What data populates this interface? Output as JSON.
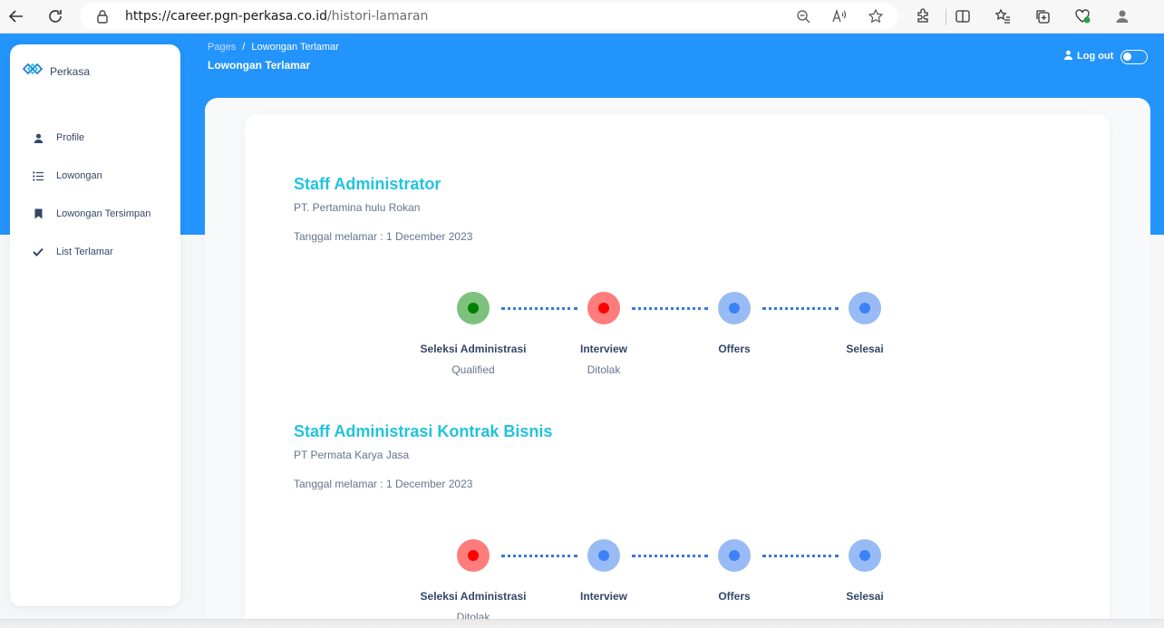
{
  "browser": {
    "url_host": "https://career.pgn-perkasa.co.id",
    "url_path": "/histori-lamaran"
  },
  "sidebar": {
    "brand": "Perkasa",
    "items": [
      {
        "label": "Profile",
        "icon": "user-icon"
      },
      {
        "label": "Lowongan",
        "icon": "list-icon"
      },
      {
        "label": "Lowongan Tersimpan",
        "icon": "bookmark-icon"
      },
      {
        "label": "List Terlamar",
        "icon": "check-icon"
      }
    ]
  },
  "header": {
    "breadcrumb_root": "Pages",
    "breadcrumb_sep": "/",
    "breadcrumb_current": "Lowongan Terlamar",
    "title": "Lowongan Terlamar",
    "logout_label": "Log out"
  },
  "colors": {
    "header_blue": "#2394fb",
    "title_cyan": "#22c3dd",
    "qualified_green": "#008000",
    "rejected_red": "#ff0000",
    "pending_blue": "#3b82f6"
  },
  "applications": [
    {
      "title": "Staff Administrator",
      "company": "PT. Pertamina hulu Rokan",
      "date": "Tanggal melamar : 1 December 2023",
      "steps": [
        {
          "label": "Seleksi Administrasi",
          "status": "Qualified",
          "state": "qualified"
        },
        {
          "label": "Interview",
          "status": "Ditolak",
          "state": "rejected"
        },
        {
          "label": "Offers",
          "status": "",
          "state": "pending"
        },
        {
          "label": "Selesai",
          "status": "",
          "state": "pending"
        }
      ]
    },
    {
      "title": "Staff Administrasi Kontrak Bisnis",
      "company": "PT Permata Karya Jasa",
      "date": "Tanggal melamar : 1 December 2023",
      "steps": [
        {
          "label": "Seleksi Administrasi",
          "status": "Ditolak",
          "state": "rejected"
        },
        {
          "label": "Interview",
          "status": "",
          "state": "pending"
        },
        {
          "label": "Offers",
          "status": "",
          "state": "pending"
        },
        {
          "label": "Selesai",
          "status": "",
          "state": "pending"
        }
      ]
    }
  ]
}
